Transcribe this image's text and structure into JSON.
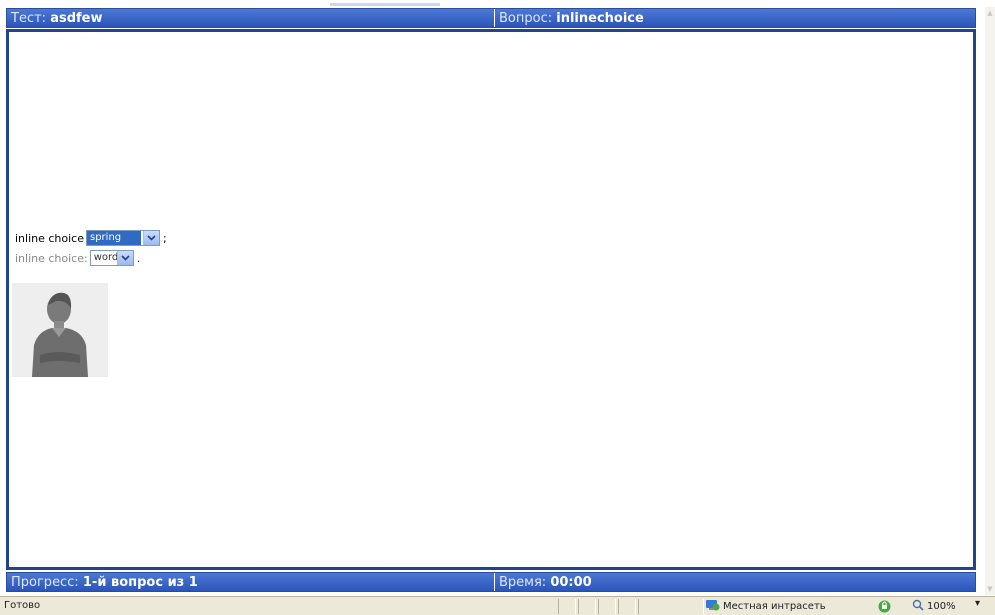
{
  "header": {
    "test_label": "Тест:",
    "test_value": "asdfew",
    "question_label": "Вопрос:",
    "question_value": "inlinechoice"
  },
  "question": {
    "line1_prompt": "inline choice",
    "line1_selected": "spring",
    "line1_suffix": ";",
    "line2_prompt": "inline choice:",
    "line2_selected": "word",
    "line2_suffix": "."
  },
  "footer": {
    "progress_label": "Прогресс:",
    "progress_value": "1-й вопрос из 1",
    "time_label": "Время:",
    "time_value": "00:00"
  },
  "statusbar": {
    "status_text": "Готово",
    "zone_text": "Местная интрасеть",
    "zoom_text": "100%",
    "zoom_arrow": "▾"
  },
  "colors": {
    "bar_blue": "#2b55b8",
    "border_blue": "#21448f",
    "selection_blue": "#316ac5"
  },
  "icons": {
    "dropdown": "chevron-down-icon",
    "zone": "globe-icon",
    "secure": "secure-icon",
    "zoom": "magnifier-icon"
  }
}
